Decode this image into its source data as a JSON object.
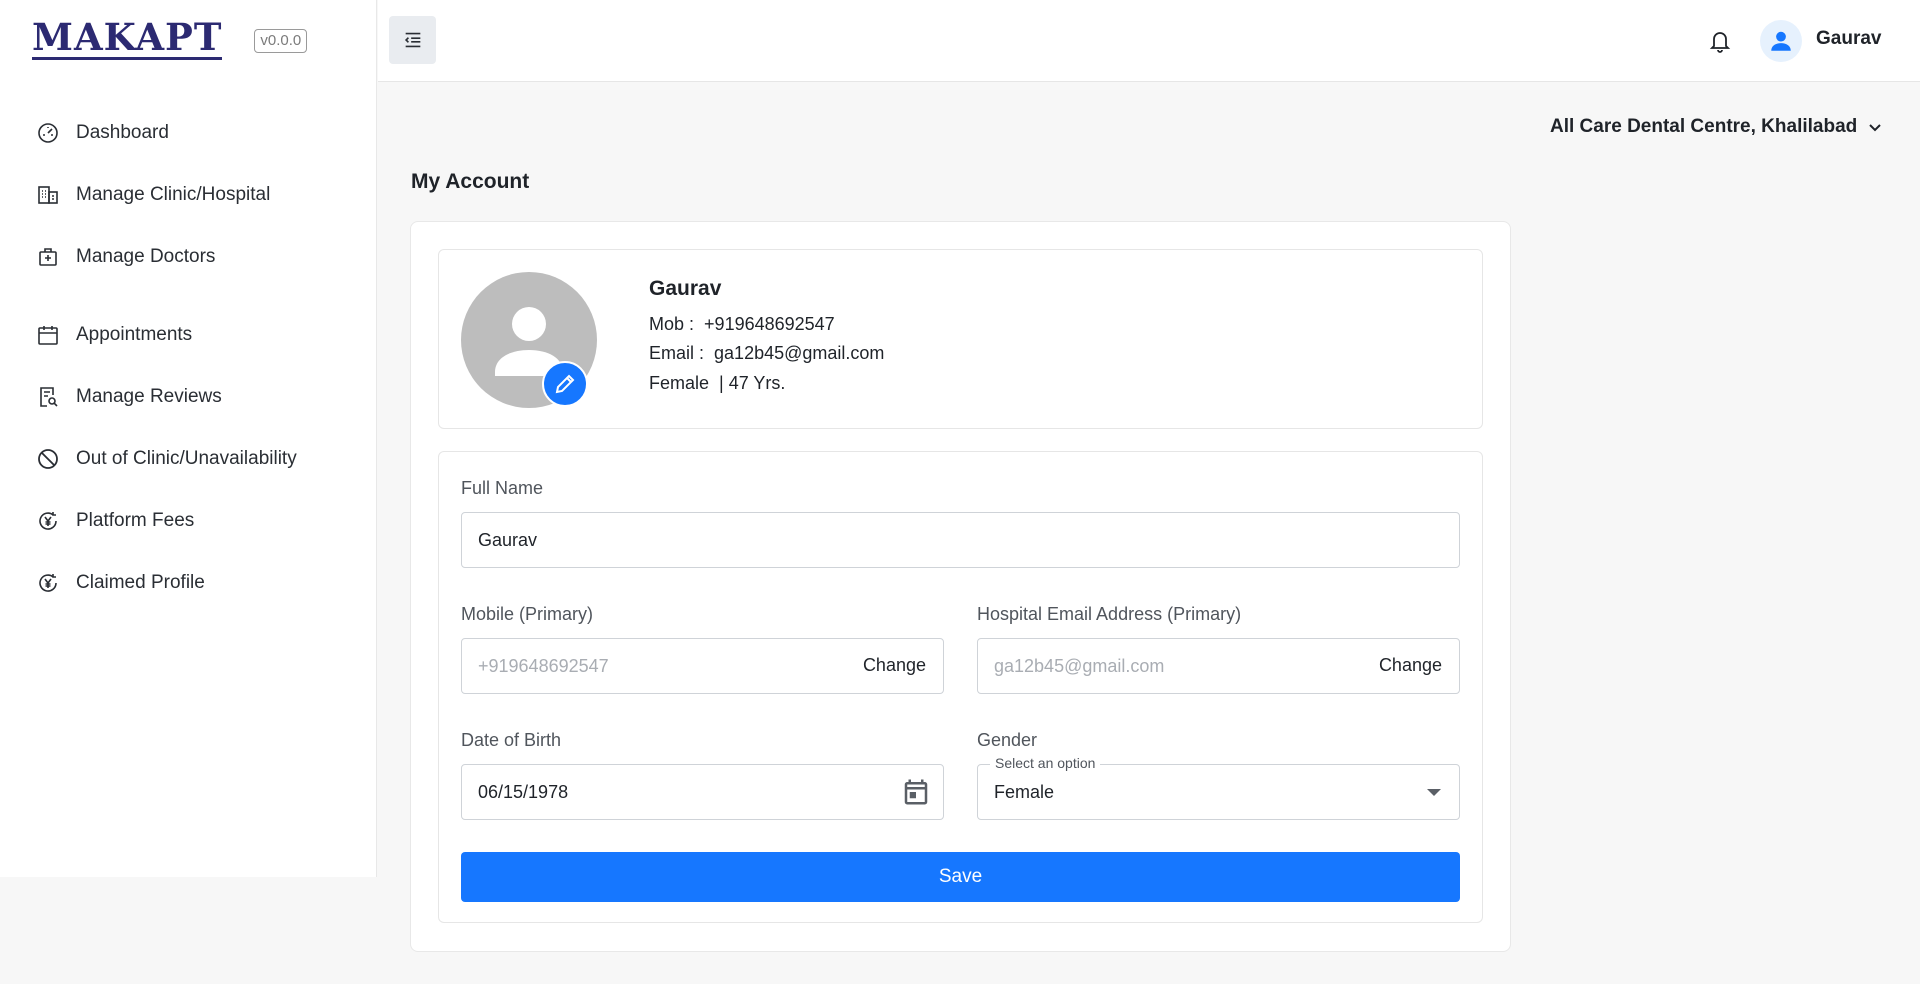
{
  "sidebar": {
    "logo_text": "MAKAPT",
    "version": "v0.0.0",
    "items": [
      {
        "label": "Dashboard",
        "icon": "gauge-icon"
      },
      {
        "label": "Manage Clinic/Hospital",
        "icon": "building-icon"
      },
      {
        "label": "Manage Doctors",
        "icon": "medical-bag-icon"
      },
      {
        "label": "Appointments",
        "icon": "calendar-icon"
      },
      {
        "label": "Manage Reviews",
        "icon": "review-search-icon"
      },
      {
        "label": "Out of Clinic/Unavailability",
        "icon": "block-icon"
      },
      {
        "label": "Platform Fees",
        "icon": "currency-refresh-icon"
      },
      {
        "label": "Claimed Profile",
        "icon": "currency-refresh-icon"
      }
    ]
  },
  "header": {
    "user_name": "Gaurav"
  },
  "clinic_selector": {
    "value": "All Care Dental Centre, Khalilabad"
  },
  "page": {
    "title": "My Account"
  },
  "profile": {
    "name": "Gaurav",
    "mobile_label": "Mob :",
    "mobile": "+919648692547",
    "email_label": "Email :",
    "email": "ga12b45@gmail.com",
    "gender": "Female",
    "age": "| 47 Yrs."
  },
  "form": {
    "full_name_label": "Full Name",
    "full_name_value": "Gaurav",
    "mobile_label": "Mobile (Primary)",
    "mobile_placeholder": "+919648692547",
    "mobile_change": "Change",
    "email_label": "Hospital Email Address (Primary)",
    "email_placeholder": "ga12b45@gmail.com",
    "email_change": "Change",
    "dob_label": "Date of Birth",
    "dob_value": "06/15/1978",
    "gender_label": "Gender",
    "gender_legend": "Select an option",
    "gender_value": "Female",
    "save_label": "Save"
  },
  "colors": {
    "accent": "#1677ff",
    "logo": "#2c2a72"
  }
}
